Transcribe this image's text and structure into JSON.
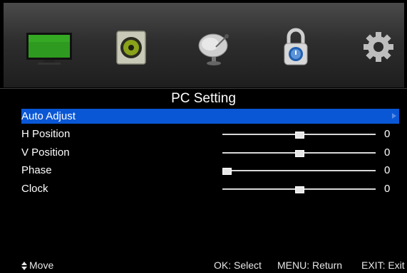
{
  "menu_tabs": [
    {
      "icon": "tv-picture-icon",
      "selected": true
    },
    {
      "icon": "speaker-sound-icon",
      "selected": false
    },
    {
      "icon": "satellite-dish-icon",
      "selected": false
    },
    {
      "icon": "padlock-icon",
      "selected": false
    },
    {
      "icon": "gear-icon",
      "selected": false
    }
  ],
  "page_title": "PC Setting",
  "items": [
    {
      "label": "Auto Adjust",
      "type": "action",
      "selected": true
    },
    {
      "label": "H Position",
      "type": "slider",
      "value": "0",
      "level": 0.5
    },
    {
      "label": "V Position",
      "type": "slider",
      "value": "0",
      "level": 0.5
    },
    {
      "label": "Phase",
      "type": "slider",
      "value": "0",
      "level": 0.0
    },
    {
      "label": "Clock",
      "type": "slider",
      "value": "0",
      "level": 0.5
    }
  ],
  "footer": {
    "move": "Move",
    "ok": "OK: Select",
    "menu": "MENU: Return",
    "exit": "EXIT: Exit"
  },
  "colors": {
    "background": "#000000",
    "highlight": "#0a57d6",
    "text": "#ffffff",
    "tv_screen": "#2e9a1f"
  }
}
